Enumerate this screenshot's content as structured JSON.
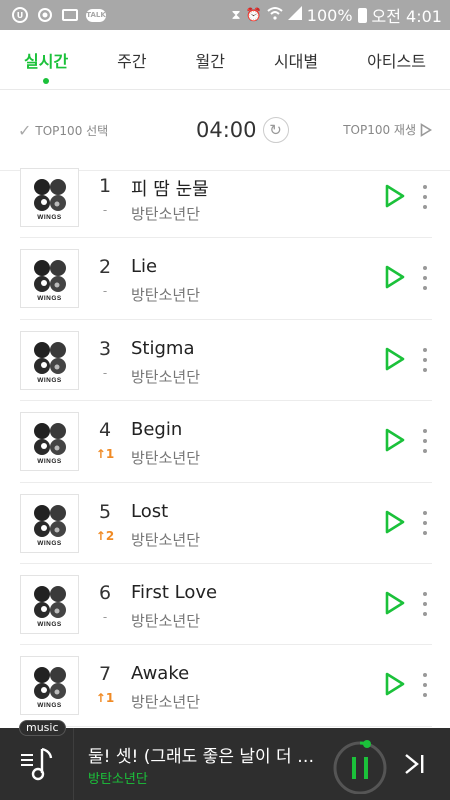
{
  "status_bar": {
    "left_icons": [
      "u-icon",
      "camera-icon",
      "mail-icon",
      "talk-icon"
    ],
    "talk_label": "TALK",
    "battery": "100%",
    "time": "오전 4:01",
    "colors": {
      "background": "#a8a8a8"
    }
  },
  "tabs": [
    {
      "label": "실시간",
      "active": true
    },
    {
      "label": "주간",
      "active": false
    },
    {
      "label": "월간",
      "active": false
    },
    {
      "label": "시대별",
      "active": false
    },
    {
      "label": "아티스트",
      "active": false
    }
  ],
  "toolbar": {
    "select_label": "TOP100 선택",
    "clock": "04:00",
    "play_label": "TOP100 재생"
  },
  "songs": [
    {
      "rank": "1",
      "change": "-",
      "title": "피 땀 눈물",
      "artist": "방탄소년단",
      "album_text": "WINGS"
    },
    {
      "rank": "2",
      "change": "-",
      "title": "Lie",
      "artist": "방탄소년단",
      "album_text": "WINGS"
    },
    {
      "rank": "3",
      "change": "-",
      "title": "Stigma",
      "artist": "방탄소년단",
      "album_text": "WINGS"
    },
    {
      "rank": "4",
      "change": "↑1",
      "title": "Begin",
      "artist": "방탄소년단",
      "album_text": "WINGS"
    },
    {
      "rank": "5",
      "change": "↑2",
      "title": "Lost",
      "artist": "방탄소년단",
      "album_text": "WINGS"
    },
    {
      "rank": "6",
      "change": "-",
      "title": "First Love",
      "artist": "방탄소년단",
      "album_text": "WINGS"
    },
    {
      "rank": "7",
      "change": "↑1",
      "title": "Awake",
      "artist": "방탄소년단",
      "album_text": "WINGS"
    }
  ],
  "player": {
    "badge": "music",
    "title": "둘! 셋! (그래도 좋은 날이 더 많기를)",
    "artist": "방탄소년단"
  },
  "colors": {
    "accent": "#1bc13a",
    "rank_up": "#f08a24",
    "player_bg": "#2e2e2e"
  }
}
